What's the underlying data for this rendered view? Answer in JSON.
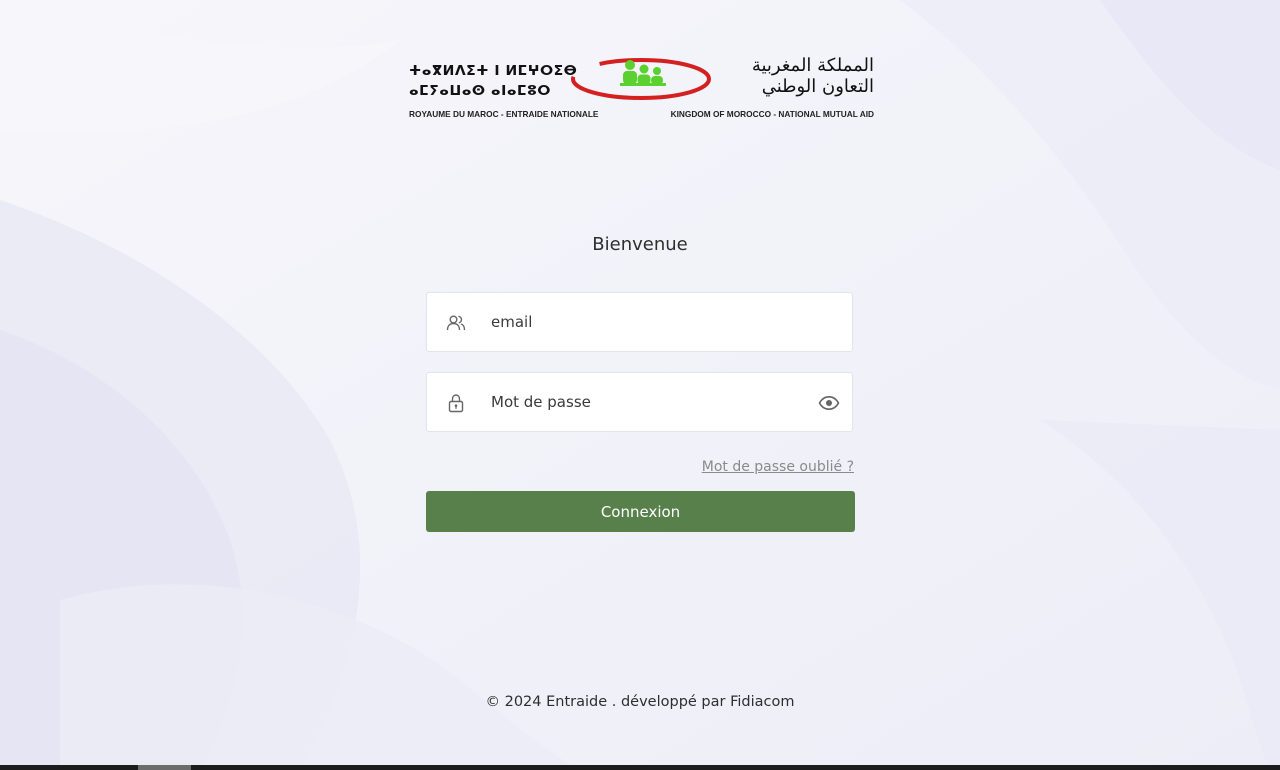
{
  "logo": {
    "tifinagh_line1": "ⵜⴰⴳⵍⴷⵉⵜ ⵏ ⵍⵎⵖⵔⵉⴱ",
    "tifinagh_line2": "ⴰⵎⵢⴰⵡⴰⵙ ⴰⵏⴰⵎⵓⵔ",
    "caption_fr": "ROYAUME DU MAROC - ENTRAIDE NATIONALE",
    "arabic_line1": "المملكة المغربية",
    "arabic_line2": "التعاون الوطني",
    "caption_en": "KINGDOM OF MOROCCO - NATIONAL MUTUAL AID",
    "emblem_icon": "people-group-emblem-icon",
    "colors": {
      "ring": "#d42020",
      "people": "#5ad12f"
    }
  },
  "login": {
    "title": "Bienvenue",
    "email_placeholder": "email",
    "email_value": "",
    "email_icon": "users-icon",
    "password_placeholder": "Mot de passe",
    "password_value": "",
    "password_icon": "lock-icon",
    "toggle_icon": "eye-icon",
    "forgot_label": "Mot de passe oublié ?",
    "submit_label": "Connexion"
  },
  "footer": {
    "text": "© 2024 Entraide . développé par Fidiacom"
  },
  "colors": {
    "primary_button": "#58804a",
    "background": "#f4f4fb",
    "link": "#8a8a8a"
  }
}
